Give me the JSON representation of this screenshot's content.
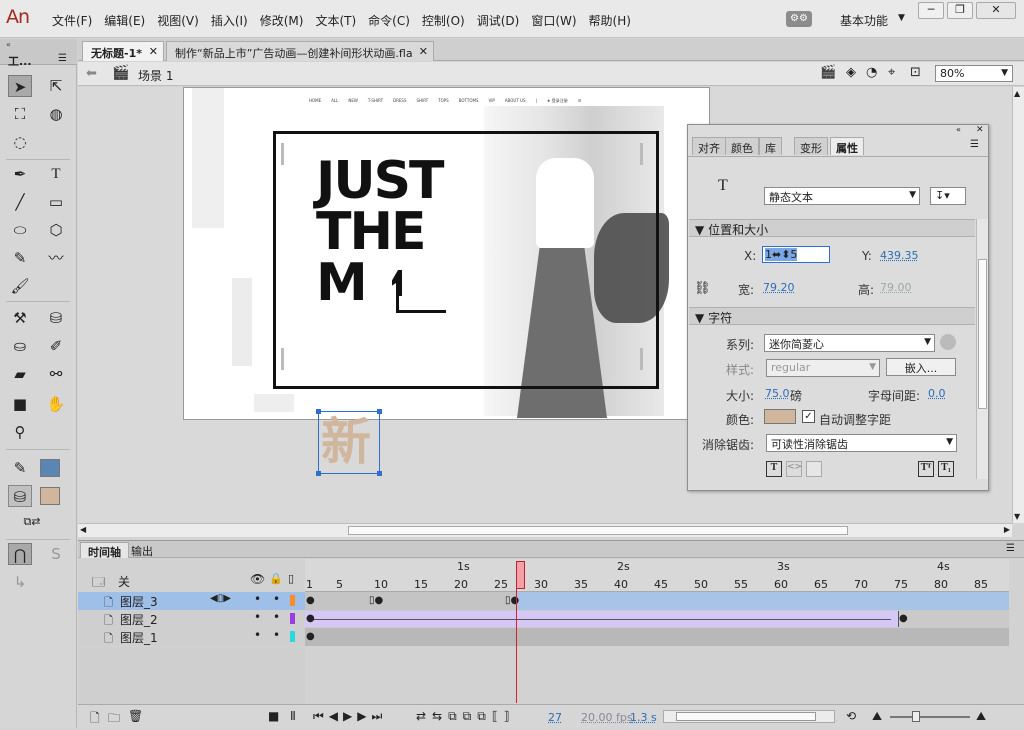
{
  "app": {
    "logo": "An"
  },
  "menu": [
    "文件(F)",
    "编辑(E)",
    "视图(V)",
    "插入(I)",
    "修改(M)",
    "文本(T)",
    "命令(C)",
    "控制(O)",
    "调试(D)",
    "窗口(W)",
    "帮助(H)"
  ],
  "workspace": {
    "label": "基本功能"
  },
  "toolbar": {
    "title": "工..."
  },
  "doc_tabs": [
    {
      "label": "无标题-1*"
    },
    {
      "label": "制作“新品上市”广告动画—创建补间形状动画.fla"
    }
  ],
  "editbar": {
    "scene": "场景 1",
    "zoom": "80%"
  },
  "stage": {
    "nav": [
      "HOME",
      "ALL",
      "NEW",
      "T-SHIRT",
      "DRESS",
      "SHIRT",
      "TOPS",
      "BOTTOMS",
      "VIP",
      "ABOUT US",
      "|",
      "★ 登录注册",
      "☰"
    ],
    "headline_lines": [
      "JUST",
      "THE",
      "M"
    ],
    "new_char": "新"
  },
  "properties": {
    "tabs": [
      "对齐",
      "颜色",
      "库",
      "变形",
      "属性"
    ],
    "tool_glyph": "T",
    "text_type": "静态文本",
    "section_position": "位置和大小",
    "x_label": "X:",
    "x_value": "1⬌⬍5",
    "y_label": "Y:",
    "y_value": "439.35",
    "w_label": "宽:",
    "w_value": "79.20",
    "h_label": "高:",
    "h_value": "79.00",
    "section_char": "字符",
    "family_label": "系列:",
    "family_value": "迷你简菱心",
    "style_label": "样式:",
    "style_value": "regular",
    "embed_label": "嵌入...",
    "size_label": "大小:",
    "size_value": "75.0",
    "size_unit": "磅",
    "spacing_label": "字母间距:",
    "spacing_value": "0.0",
    "color_label": "颜色:",
    "color_swatch": "#d0b69c",
    "kerning_label": "自动调整字距",
    "aa_label": "消除锯齿:",
    "aa_value": "可读性消除锯齿"
  },
  "timeline": {
    "tabs": [
      "时间轴",
      "输出"
    ],
    "header_label": "关",
    "seconds": [
      "1s",
      "2s",
      "3s",
      "4s"
    ],
    "frame_numbers": [
      "1",
      "5",
      "10",
      "15",
      "20",
      "25",
      "30",
      "35",
      "40",
      "45",
      "50",
      "55",
      "60",
      "65",
      "70",
      "75",
      "80",
      "85"
    ],
    "layers": [
      {
        "name": "图层_3"
      },
      {
        "name": "图层_2"
      },
      {
        "name": "图层_1"
      }
    ],
    "current_frame": "27",
    "fps": "20.00 fps",
    "time": "1.3 s"
  }
}
